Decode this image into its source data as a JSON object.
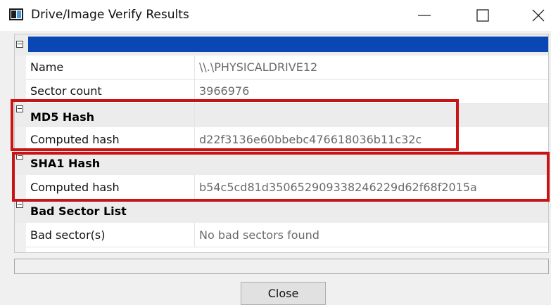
{
  "window": {
    "title": "Drive/Image Verify Results",
    "app_icon": "application-window-icon",
    "controls": [
      "minimize-icon",
      "maximize-icon",
      "close-icon"
    ]
  },
  "grid": {
    "drive": {
      "properties": [
        {
          "name": "Name",
          "value": "\\\\.\\PHYSICALDRIVE12"
        },
        {
          "name": "Sector count",
          "value": "3966976"
        }
      ]
    },
    "md5": {
      "label": "MD5 Hash",
      "properties": [
        {
          "name": "Computed hash",
          "value": "d22f3136e60bbebc476618036b11c32c"
        }
      ]
    },
    "sha1": {
      "label": "SHA1 Hash",
      "properties": [
        {
          "name": "Computed hash",
          "value": "b54c5cd81d350652909338246229d62f68f2015a"
        }
      ]
    },
    "bad_sectors": {
      "label": "Bad Sector List",
      "properties": [
        {
          "name": "Bad sector(s)",
          "value": "No bad sectors found"
        }
      ]
    }
  },
  "footer": {
    "close_label": "Close"
  },
  "colors": {
    "selection": "#0b46b5",
    "highlight_box": "#c81414",
    "value_text": "#6a6a6a"
  }
}
